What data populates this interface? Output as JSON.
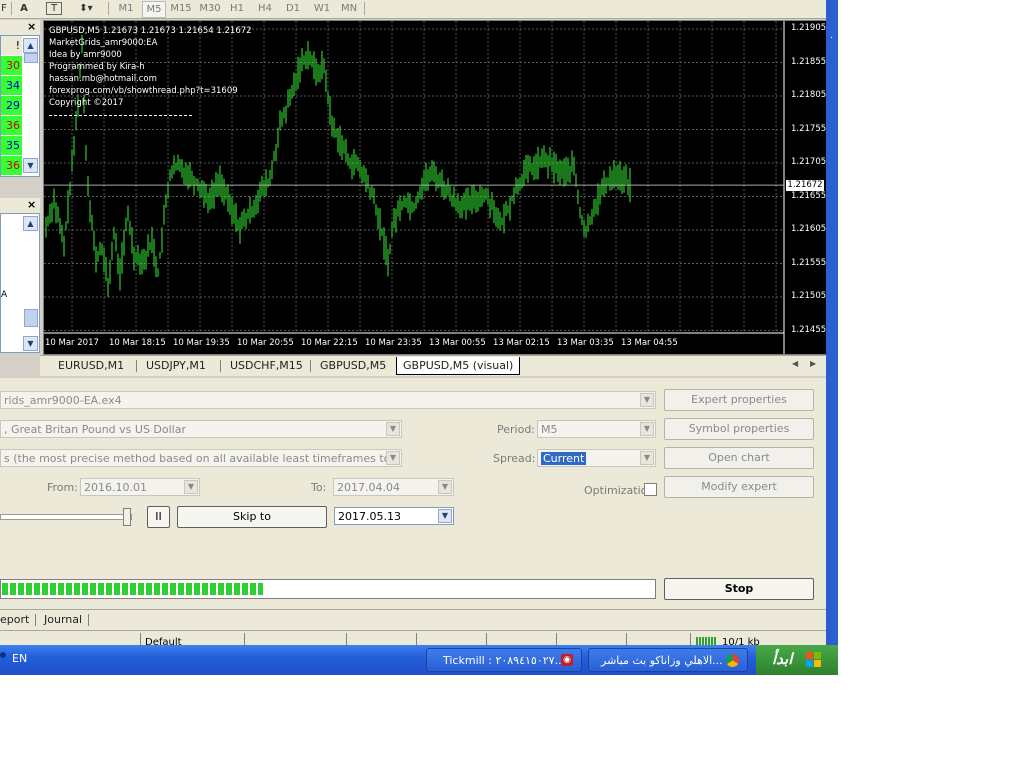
{
  "toolbar": {
    "left_glyphs": [
      "F",
      "A",
      "T"
    ],
    "timeframes": [
      "M1",
      "M5",
      "M15",
      "M30",
      "H1",
      "H4",
      "D1",
      "W1",
      "MN"
    ]
  },
  "market_watch": {
    "flag": "!",
    "values": [
      "30",
      "34",
      "29",
      "36",
      "35",
      "36"
    ]
  },
  "navigator": {
    "fragment": "A"
  },
  "chart": {
    "info_lines": [
      "GBPUSD,M5  1.21673 1.21673 1.21654 1.21672",
      "MarketGrids_amr9000:EA",
      "Idea by amr9000",
      "Programmed by Kira-h",
      "hassan.mb@hotmail.com",
      "forexprog.com/vb/showthread.php?t=31609",
      "Copyright ©2017"
    ],
    "price_labels": [
      "1.21905",
      "1.21855",
      "1.21805",
      "1.21755",
      "1.21705",
      "1.21655",
      "1.21605",
      "1.21555",
      "1.21505",
      "1.21455"
    ],
    "current_price": "1.21672",
    "time_labels": [
      "10 Mar 2017",
      "10 Mar 18:15",
      "10 Mar 19:35",
      "10 Mar 20:55",
      "10 Mar 22:15",
      "10 Mar 23:35",
      "13 Mar 00:55",
      "13 Mar 02:15",
      "13 Mar 03:35",
      "13 Mar 04:55"
    ],
    "price_min": 1.21455,
    "price_max": 1.21905,
    "colors": {
      "background": "#000000",
      "grid": "#5a5a5a",
      "bars": "#33ee33",
      "text": "#ffffff"
    }
  },
  "chart_tabs": [
    "EURUSD,M1",
    "USDJPY,M1",
    "USDCHF,M15",
    "GBPUSD,M5",
    "GBPUSD,M5 (visual)"
  ],
  "tester": {
    "expert": "rids_amr9000-EA.ex4",
    "symbol": ", Great Britan Pound vs US Dollar",
    "model": "s (the most precise method based on all available least timeframes to generate eac",
    "period_label": "Period:",
    "period_value": "M5",
    "spread_label": "Spread:",
    "spread_value": "Current",
    "from_label": "From:",
    "from_value": "2016.10.01",
    "to_label": "To:",
    "to_value": "2017.04.04",
    "optimization_label": "Optimization",
    "pause_label": "II",
    "skip_to_label": "Skip to",
    "skip_date": "2017.05.13",
    "buttons": {
      "expert_properties": "Expert properties",
      "symbol_properties": "Symbol properties",
      "open_chart": "Open chart",
      "modify_expert": "Modify expert",
      "stop": "Stop"
    },
    "progress": 0.4,
    "progress_color": "#2fcf2f"
  },
  "bottom_tabs": [
    "eport",
    "Journal"
  ],
  "status_bar": {
    "profile": "Default",
    "traffic": "10/1 kb"
  },
  "taskbar": {
    "language": "EN",
    "task1": "Tickmill : ۲۰۸۹٤۱٥۰۲۷...",
    "task2": "الاهلي وزاناكو بث مباشر...",
    "start_label": "ابدأ"
  }
}
